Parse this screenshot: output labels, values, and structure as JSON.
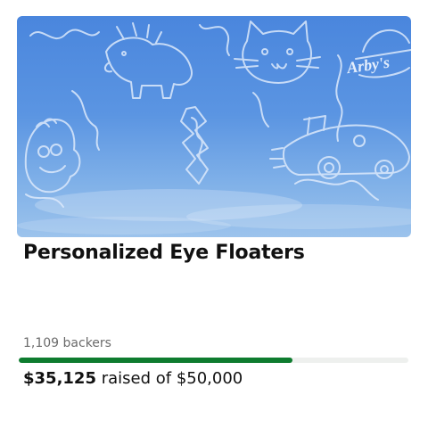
{
  "project": {
    "title": "Personalized Eye Floaters",
    "image_alt": "Sky with floater doodles",
    "brand_in_image": "Arby's",
    "backers_text": "1,109 backers",
    "raised_amount": "$35,125",
    "raised_of_text": "raised of $50,000",
    "progress_fraction": 0.7025
  },
  "colors": {
    "progress_fill": "#0e7c2f",
    "progress_track": "#eef0ee",
    "sky": "#5b95e2"
  }
}
